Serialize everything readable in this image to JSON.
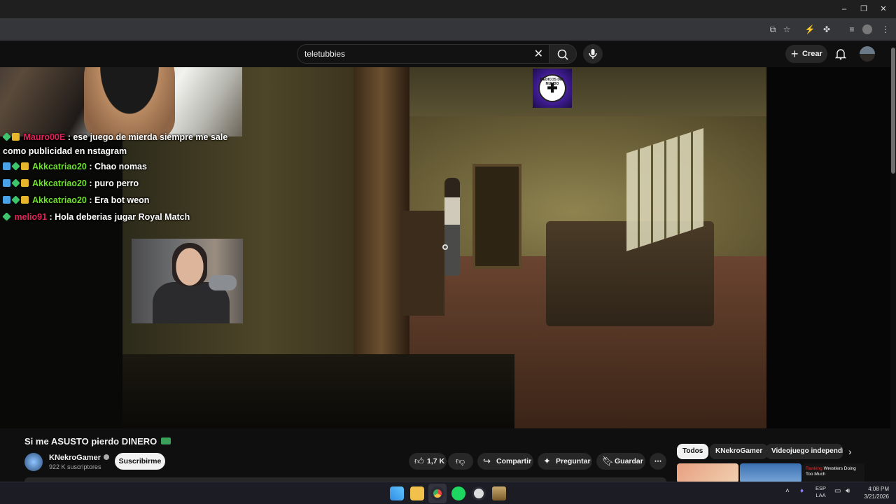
{
  "browser": {
    "window_controls": [
      "–",
      "❐",
      "✕"
    ]
  },
  "youtube_header": {
    "search_value": "teletubbies",
    "create_label": "Crear"
  },
  "stream_overlay": {
    "logo_text": "MÉDICOS DEL MUNDO",
    "chat": [
      {
        "badges": [
          "green",
          "gold"
        ],
        "username": "Mauro00E",
        "username_color": "#e0245a",
        "message": "ese juego de mierda siempre me sale como publicidad en nstagram"
      },
      {
        "badges": [
          "blue",
          "green",
          "gold"
        ],
        "username": "Akkcatriao20",
        "username_color": "#6ee02c",
        "message": "Chao nomas"
      },
      {
        "badges": [
          "blue",
          "green",
          "gold"
        ],
        "username": "Akkcatriao20",
        "username_color": "#6ee02c",
        "message": "puro perro"
      },
      {
        "badges": [
          "blue",
          "green",
          "gold"
        ],
        "username": "Akkcatriao20",
        "username_color": "#6ee02c",
        "message": "Era bot weon"
      },
      {
        "badges": [
          "green"
        ],
        "username": "melio91",
        "username_color": "#e0245a",
        "message": "Hola deberias jugar Royal Match"
      }
    ]
  },
  "video": {
    "title": "Si me ASUSTO pierdo DINERO",
    "channel": {
      "name": "KNekroGamer",
      "subscribers": "922 K suscriptores",
      "subscribe_label": "Suscribirme"
    },
    "actions": {
      "likes": "1,7 K",
      "share": "Compartir",
      "ask": "Preguntar",
      "save": "Guardar"
    }
  },
  "recommendations": {
    "chips": [
      "Todos",
      "KNekroGamer",
      "Videojuego independiente"
    ],
    "thumb3": {
      "highlight": "Ranking",
      "text": "Wrestlers Doing Too Much"
    }
  },
  "taskbar": {
    "lang_top": "ESP",
    "lang_bottom": "LAA",
    "time": "4:08 PM",
    "date": "3/21/2026"
  }
}
